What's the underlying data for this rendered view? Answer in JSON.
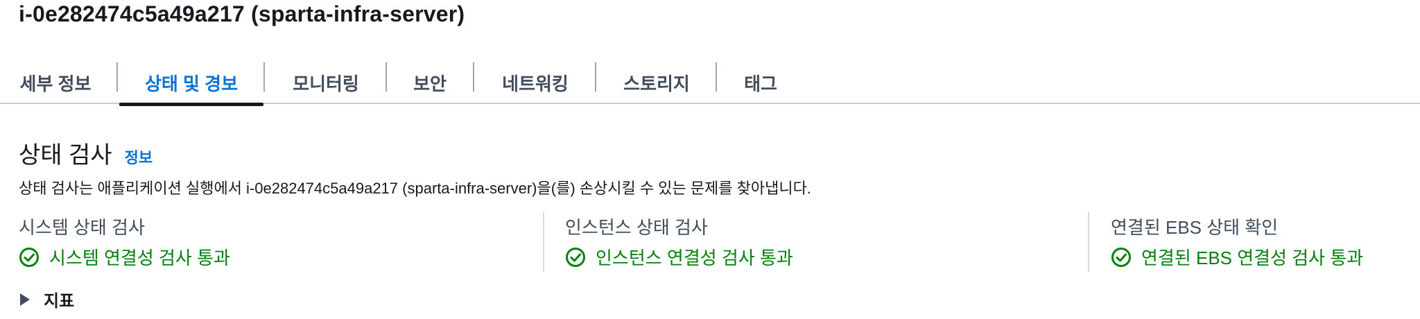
{
  "header": {
    "title": "i-0e282474c5a49a217 (sparta-infra-server)"
  },
  "tabs": [
    {
      "label": "세부 정보",
      "active": false
    },
    {
      "label": "상태 및 경보",
      "active": true
    },
    {
      "label": "모니터링",
      "active": false
    },
    {
      "label": "보안",
      "active": false
    },
    {
      "label": "네트워킹",
      "active": false
    },
    {
      "label": "스토리지",
      "active": false
    },
    {
      "label": "태그",
      "active": false
    }
  ],
  "status_checks": {
    "title": "상태 검사",
    "info_link": "정보",
    "description": "상태 검사는 애플리케이션 실행에서 i-0e282474c5a49a217 (sparta-infra-server)을(를) 손상시킬 수 있는 문제를 찾아냅니다.",
    "columns": [
      {
        "label": "시스템 상태 검사",
        "status": "시스템 연결성 검사 통과",
        "icon": "check-circle-icon"
      },
      {
        "label": "인스턴스 상태 검사",
        "status": "인스턴스 연결성 검사 통과",
        "icon": "check-circle-icon"
      },
      {
        "label": "연결된 EBS 상태 확인",
        "status": "연결된 EBS 연결성 검사 통과",
        "icon": "check-circle-icon"
      }
    ]
  },
  "metrics": {
    "label": "지표",
    "icon": "caret-right-icon"
  },
  "colors": {
    "link": "#0972d3",
    "success": "#037f0c",
    "text": "#16191f",
    "muted": "#414d5c"
  }
}
